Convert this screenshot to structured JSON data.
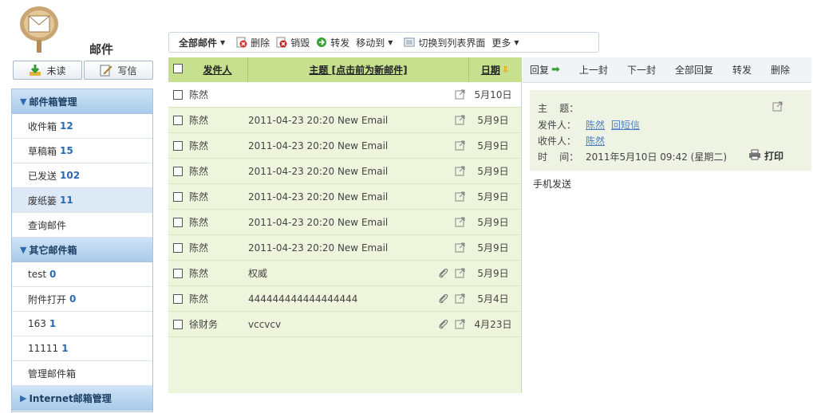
{
  "sidebar": {
    "title": "邮件",
    "unread_label": "未读",
    "compose_label": "写信",
    "sections": [
      {
        "title": "邮件箱管理",
        "items": [
          {
            "label": "收件箱",
            "count": "12"
          },
          {
            "label": "草稿箱",
            "count": "15"
          },
          {
            "label": "已发送",
            "count": "102"
          },
          {
            "label": "废纸篓",
            "count": "11",
            "selected": true
          },
          {
            "label": "查询邮件",
            "count": ""
          }
        ]
      },
      {
        "title": "其它邮件箱",
        "items": [
          {
            "label": "test",
            "count": "0"
          },
          {
            "label": "附件打开",
            "count": "0"
          },
          {
            "label": "163",
            "count": "1"
          },
          {
            "label": "11111",
            "count": "1"
          },
          {
            "label": "管理邮件箱",
            "count": ""
          }
        ]
      },
      {
        "title": "Internet邮箱管理",
        "items": []
      }
    ]
  },
  "toolbar": {
    "all_mail": "全部邮件",
    "delete": "删除",
    "destroy": "销毁",
    "forward": "转发",
    "move_to": "移动到",
    "switch_view": "切换到列表界面",
    "more": "更多"
  },
  "list": {
    "col_sender": "发件人",
    "col_subject": "主题 [点击前为新邮件]",
    "col_date": "日期",
    "rows": [
      {
        "sender": "陈然",
        "subject": "",
        "attach": false,
        "date": "5月10日"
      },
      {
        "sender": "陈然",
        "subject": "2011-04-23 20:20 New Email",
        "attach": false,
        "date": "5月9日"
      },
      {
        "sender": "陈然",
        "subject": "2011-04-23 20:20 New Email",
        "attach": false,
        "date": "5月9日"
      },
      {
        "sender": "陈然",
        "subject": "2011-04-23 20:20 New Email",
        "attach": false,
        "date": "5月9日"
      },
      {
        "sender": "陈然",
        "subject": "2011-04-23 20:20 New Email",
        "attach": false,
        "date": "5月9日"
      },
      {
        "sender": "陈然",
        "subject": "2011-04-23 20:20 New Email",
        "attach": false,
        "date": "5月9日"
      },
      {
        "sender": "陈然",
        "subject": "2011-04-23 20:20 New Email",
        "attach": false,
        "date": "5月9日"
      },
      {
        "sender": "陈然",
        "subject": "权威",
        "attach": true,
        "date": "5月9日"
      },
      {
        "sender": "陈然",
        "subject": "444444444444444444",
        "attach": true,
        "date": "5月4日"
      },
      {
        "sender": "徐财务",
        "subject": "vccvcv",
        "attach": true,
        "date": "4月23日"
      }
    ]
  },
  "reader": {
    "toolbar": {
      "reply": "回复",
      "prev": "上一封",
      "next": "下一封",
      "reply_all": "全部回复",
      "forward": "转发",
      "delete": "删除"
    },
    "subject_label": "主    题：",
    "subject_value": "",
    "from_label": "发件人：",
    "from_value": "陈然",
    "sms_reply": "回短信",
    "to_label": "收件人：",
    "to_value": "陈然",
    "time_label": "时    间：",
    "time_value": "2011年5月10日 09:42 (星期二)",
    "print_label": "打印",
    "body": "手机发送"
  },
  "colors": {
    "list_bg": "#edf6dd",
    "list_header": "#c6e08e",
    "sidebar_head": "#a8cbea",
    "link": "#4a7fc1"
  }
}
